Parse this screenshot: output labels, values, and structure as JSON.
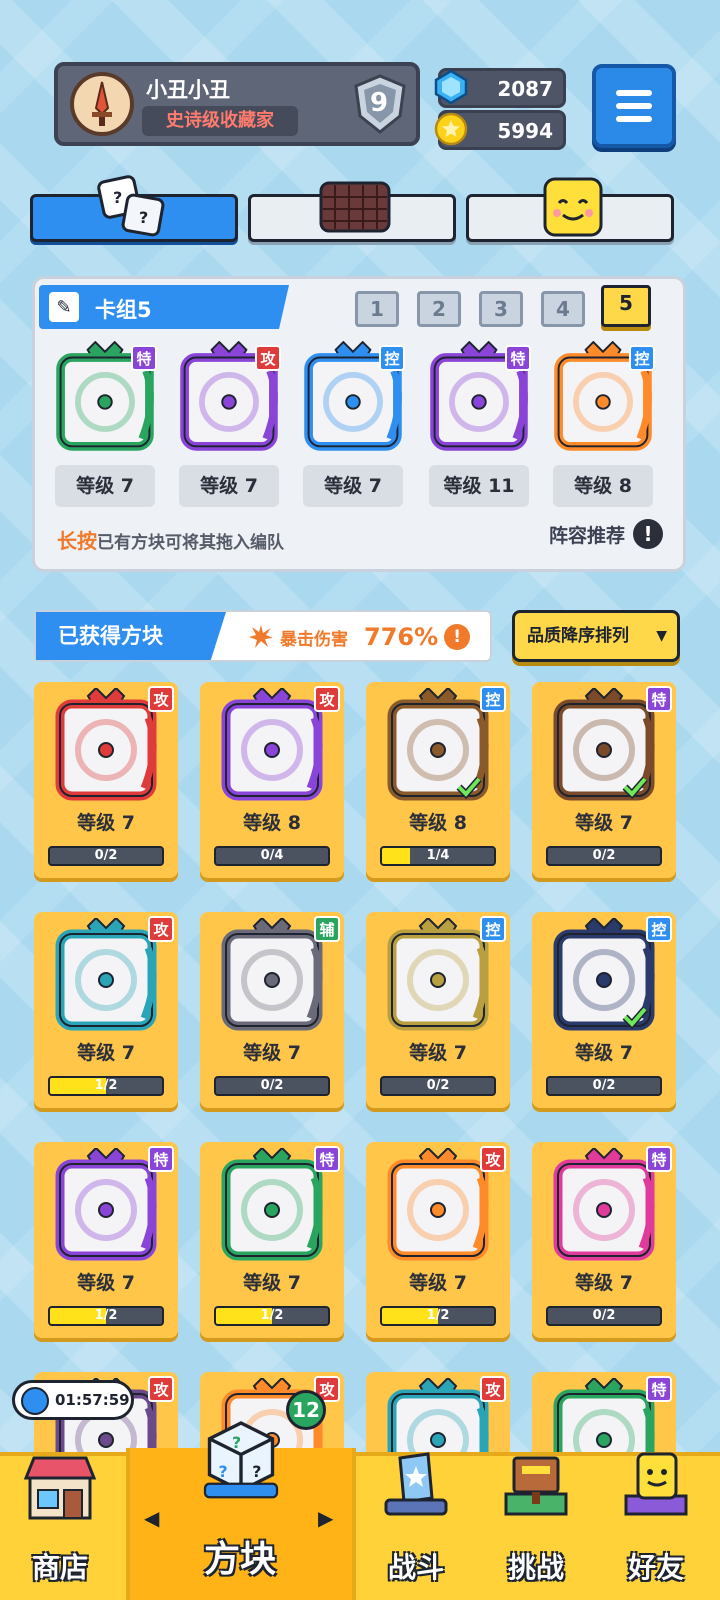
{
  "profile": {
    "name": "小丑小丑",
    "title": "史诗级收藏家",
    "rank": "9"
  },
  "currency": {
    "gems": "2087",
    "coins": "5994"
  },
  "deck": {
    "name": "卡组5",
    "tabs": [
      "1",
      "2",
      "3",
      "4",
      "5"
    ],
    "active_tab": "5",
    "slots": [
      {
        "type": "特",
        "level": "等级 7",
        "color": "#ff8a2a",
        "frame": "#2aa560"
      },
      {
        "type": "攻",
        "level": "等级 7",
        "color": "#8a45d8",
        "frame": "#8a45d8"
      },
      {
        "type": "控",
        "level": "等级 7",
        "color": "#2e8ff0",
        "frame": "#2e8ff0"
      },
      {
        "type": "特",
        "level": "等级 11",
        "color": "#8a45d8",
        "frame": "#8a45d8"
      },
      {
        "type": "控",
        "level": "等级 8",
        "color": "#ff8a2a",
        "frame": "#ff8a2a"
      }
    ],
    "hint_emph": "长按",
    "hint_rest": "已有方块可将其拖入编队",
    "recommend": "阵容推荐"
  },
  "obtained": {
    "label": "已获得方块",
    "crit_label": "暴击伤害",
    "crit_value": "776%",
    "sort_label": "品质降序排列"
  },
  "cards": [
    {
      "type": "攻",
      "level": "等级 7",
      "progress": "0/2",
      "fill": 0,
      "frame": "#e03b3b",
      "checked": false
    },
    {
      "type": "攻",
      "level": "等级 8",
      "progress": "0/4",
      "fill": 0,
      "frame": "#8a45d8",
      "checked": false
    },
    {
      "type": "控",
      "level": "等级 8",
      "progress": "1/4",
      "fill": 0.25,
      "frame": "#8a5a2a",
      "checked": true
    },
    {
      "type": "特",
      "level": "等级 7",
      "progress": "0/2",
      "fill": 0,
      "frame": "#7a4a2a",
      "checked": true
    },
    {
      "type": "攻",
      "level": "等级 7",
      "progress": "1/2",
      "fill": 0.5,
      "frame": "#2aa5b8",
      "checked": false
    },
    {
      "type": "辅",
      "level": "等级 7",
      "progress": "0/2",
      "fill": 0,
      "frame": "#6a6a78",
      "checked": false
    },
    {
      "type": "控",
      "level": "等级 7",
      "progress": "0/2",
      "fill": 0,
      "frame": "#b8a040",
      "checked": false
    },
    {
      "type": "控",
      "level": "等级 7",
      "progress": "0/2",
      "fill": 0,
      "frame": "#2a3a6a",
      "checked": true
    },
    {
      "type": "特",
      "level": "等级 7",
      "progress": "1/2",
      "fill": 0.5,
      "frame": "#8a45d8",
      "checked": false
    },
    {
      "type": "特",
      "level": "等级 7",
      "progress": "1/2",
      "fill": 0.5,
      "frame": "#2aa560",
      "checked": false
    },
    {
      "type": "攻",
      "level": "等级 7",
      "progress": "1/2",
      "fill": 0.5,
      "frame": "#ff8a2a",
      "checked": false
    },
    {
      "type": "特",
      "level": "等级 7",
      "progress": "0/2",
      "fill": 0,
      "frame": "#e03b9a",
      "checked": false
    },
    {
      "type": "攻",
      "frame": "#6a4a8a"
    },
    {
      "type": "攻",
      "frame": "#ff8a2a"
    },
    {
      "type": "攻",
      "frame": "#2aa5b8"
    },
    {
      "type": "特",
      "frame": "#2aa560"
    }
  ],
  "timer": "01:57:59",
  "nav": {
    "shop": "商店",
    "blocks": "方块",
    "blocks_badge": "12",
    "battle": "战斗",
    "challenge": "挑战",
    "friends": "好友"
  },
  "colors": {
    "accent": "#2e8ff0",
    "card": "#ffc64a",
    "nav": "#ffd23a",
    "highlight": "#ffd84a"
  }
}
